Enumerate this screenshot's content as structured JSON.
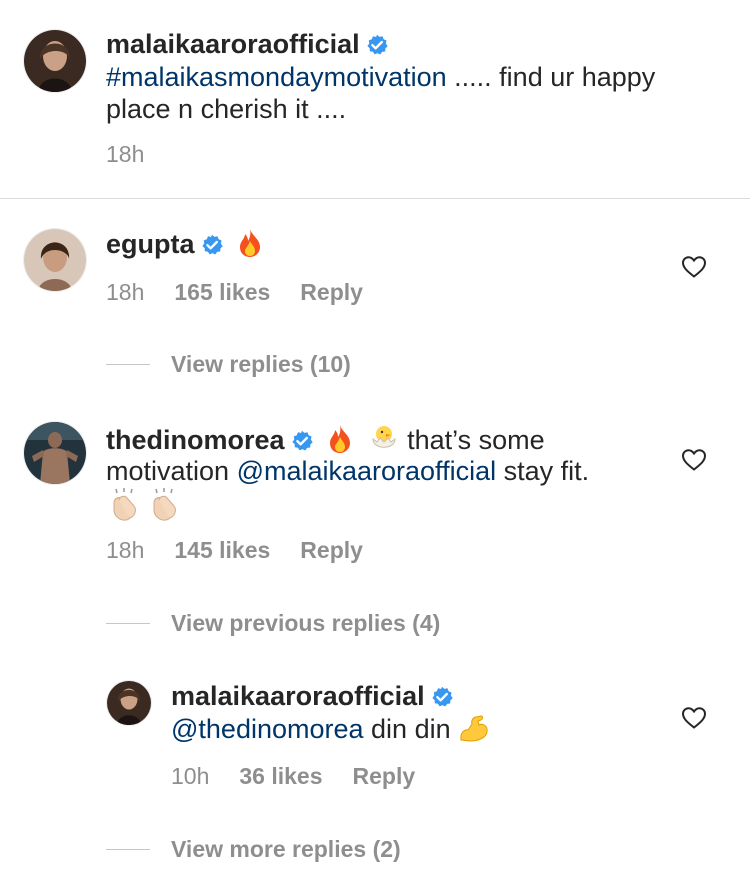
{
  "caption": {
    "username": "malaikaaroraofficial",
    "hashtag": "#malaikasmondaymotivation",
    "text_line1_rest": " ..... find ur happy",
    "text_line2": "place n cherish it ....",
    "time": "18h"
  },
  "comments": [
    {
      "username": "egupta",
      "emojis": [
        "fire-emoji"
      ],
      "time": "18h",
      "likes": "165 likes",
      "reply_label": "Reply",
      "view_replies": "View replies (10)"
    },
    {
      "username": "thedinomorea",
      "emojis": [
        "fire-emoji",
        "hatching-chick-emoji",
        "clapping-hands-emoji",
        "clapping-hands-emoji"
      ],
      "text_line1": " that’s some",
      "text_line2_a": "motivation ",
      "mention": "@malaikaaroraofficial",
      "text_line2_b": "  stay fit.",
      "time": "18h",
      "likes": "145 likes",
      "reply_label": "Reply",
      "view_replies": "View previous replies (4)"
    }
  ],
  "reply": {
    "username": "malaikaaroraofficial",
    "mention": "@thedinomorea",
    "text": " din din ",
    "emojis": [
      "flexed-biceps-emoji"
    ],
    "time": "10h",
    "likes": "36 likes",
    "reply_label": "Reply",
    "view_more": "View more replies (2)"
  },
  "icons": [
    "verified-badge-icon",
    "heart-outline-icon"
  ],
  "colors": {
    "text": "#262626",
    "secondary": "#8e8e8e",
    "link": "#003569",
    "verified": "#3897f0",
    "divider": "#dbdbdb"
  }
}
